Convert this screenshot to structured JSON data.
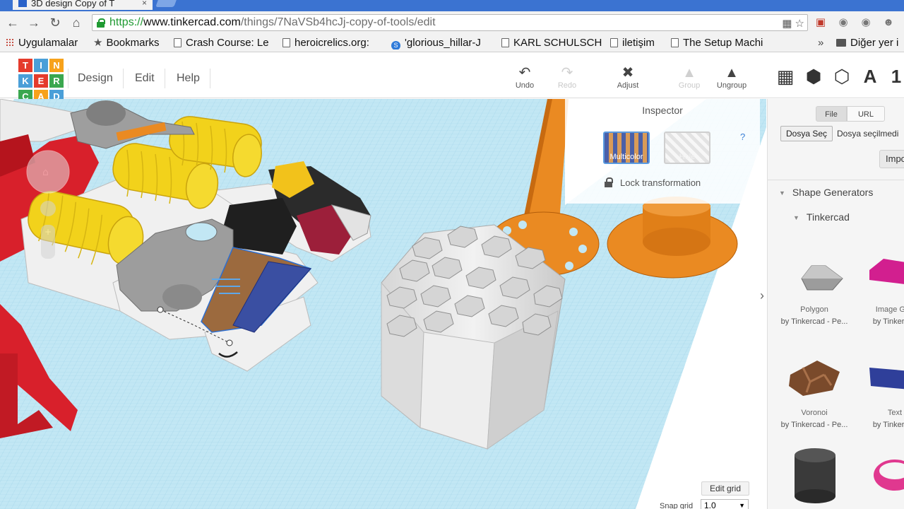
{
  "browser": {
    "tab_title": "3D design Copy of T",
    "tab_close": "×",
    "url_scheme": "https://",
    "url_host": "www.tinkercad.com",
    "url_path": "/things/7NaVSb4hcJj-copy-of-tools/edit",
    "bookmarks": [
      {
        "label": "Uygulamalar",
        "icon": "apps-icon"
      },
      {
        "label": "Bookmarks",
        "icon": "star-icon"
      },
      {
        "label": "Crash Course: Le",
        "icon": "page-icon"
      },
      {
        "label": "heroicrelics.org:",
        "icon": "page-icon"
      },
      {
        "label": "'glorious_hillar-J",
        "icon": "s-icon"
      },
      {
        "label": "KARL SCHULSCH",
        "icon": "page-icon"
      },
      {
        "label": "iletişim",
        "icon": "page-icon"
      },
      {
        "label": "The Setup Machi",
        "icon": "page-icon"
      }
    ],
    "bookmarks_overflow": "»",
    "other_bookmarks": "Diğer yer i"
  },
  "app": {
    "logo_letters": [
      "T",
      "I",
      "N",
      "K",
      "E",
      "R",
      "C",
      "A",
      "D"
    ],
    "logo_colors": [
      "#e53b2c",
      "#4a9fd8",
      "#f7a21b",
      "#4a9fd8",
      "#e53b2c",
      "#3aa74f",
      "#3aa74f",
      "#f7a21b",
      "#4a9fd8"
    ],
    "menu": {
      "design": "Design",
      "edit": "Edit",
      "help": "Help"
    },
    "tools": {
      "undo": "Undo",
      "redo": "Redo",
      "adjust": "Adjust",
      "group": "Group",
      "ungroup": "Ungroup"
    },
    "view_text_icon": "A",
    "view_number_icon": "1"
  },
  "inspector": {
    "title": "Inspector",
    "multicolor": "Multicolor",
    "hole": "Hole",
    "help": "?",
    "lock_label": "Lock transformation"
  },
  "grid": {
    "edit_grid": "Edit grid",
    "snap_label": "Snap grid",
    "snap_value": "1.0"
  },
  "sidebar": {
    "file_tab": "File",
    "url_tab": "URL",
    "choose_file": "Dosya Seç",
    "no_file": "Dosya seçilmedi",
    "import_button": "Impo",
    "section_title": "Shape Generators",
    "subsection_title": "Tinkercad",
    "shapes": [
      {
        "name": "Polygon",
        "by": "by Tinkercad - Pe..."
      },
      {
        "name": "Image Gen",
        "by": "by Tinkercad"
      },
      {
        "name": "Voronoi",
        "by": "by Tinkercad - Pe..."
      },
      {
        "name": "Text",
        "by": "by Tinkercad"
      }
    ]
  },
  "colors": {
    "workplane": "#bfe8f5",
    "browser_blue": "#3b73d1",
    "tinker_yellow": "#f2d21b",
    "tinker_orange": "#ea8a22",
    "tinker_red": "#d8202b"
  }
}
